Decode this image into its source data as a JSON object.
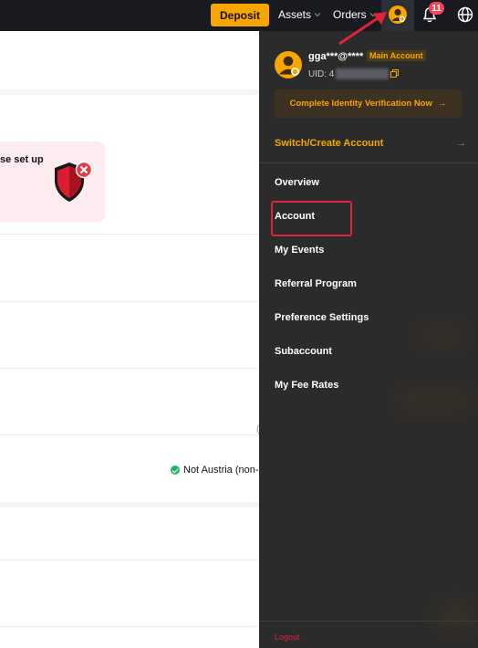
{
  "topbar": {
    "deposit_label": "Deposit",
    "assets_label": "Assets",
    "orders_label": "Orders",
    "notification_count": "11",
    "colors": {
      "background": "#181a20",
      "accent": "#f7a600",
      "badge": "#f6465d"
    }
  },
  "page": {
    "security_text": "se set up",
    "status_text": "Not Austria (non-",
    "edge_char": "(",
    "icons": {
      "shield": "shield-alert-icon",
      "status": "check-circle-icon"
    }
  },
  "account_menu": {
    "username": "gga***@****",
    "account_badge": "Main Account",
    "uid_label": "UID: 4",
    "verify_label": "Complete Identity Verification Now",
    "verify_arrow": "→",
    "switch_label": "Switch/Create Account",
    "switch_arrow": "→",
    "items": [
      {
        "label": "Overview"
      },
      {
        "label": "Account",
        "highlighted": true
      },
      {
        "label": "My Events"
      },
      {
        "label": "Referral Program"
      },
      {
        "label": "Preference Settings"
      },
      {
        "label": "Subaccount"
      },
      {
        "label": "My Fee Rates"
      }
    ],
    "logout_label": "Logout",
    "colors": {
      "panel": "#2b2b2b",
      "accent": "#f7a600",
      "highlight": "#e0233a"
    }
  }
}
